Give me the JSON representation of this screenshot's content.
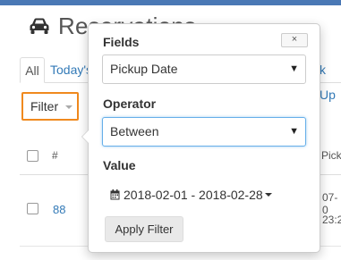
{
  "header": {
    "title": "Reservations",
    "icon": "car-icon"
  },
  "tabs": [
    {
      "label": "All"
    },
    {
      "label": "Today's"
    },
    {
      "label": "k Up"
    }
  ],
  "toolbar": {
    "filter_label": "Filter"
  },
  "table": {
    "columns": [
      "#",
      "Pick"
    ],
    "rows": [
      {
        "id": "88",
        "date_line1": "07-0",
        "date_line2": "23:2"
      }
    ]
  },
  "filter_popover": {
    "close_label": "×",
    "fields_label": "Fields",
    "fields_selected": "Pickup Date",
    "operator_label": "Operator",
    "operator_selected": "Between",
    "value_label": "Value",
    "value_text": "2018-02-01 - 2018-02-28",
    "apply_label": "Apply Filter"
  },
  "colors": {
    "accent_orange": "#f0891e",
    "link_blue": "#337ab7",
    "focus_blue": "#66afe9",
    "topbar": "#4a78b5"
  }
}
